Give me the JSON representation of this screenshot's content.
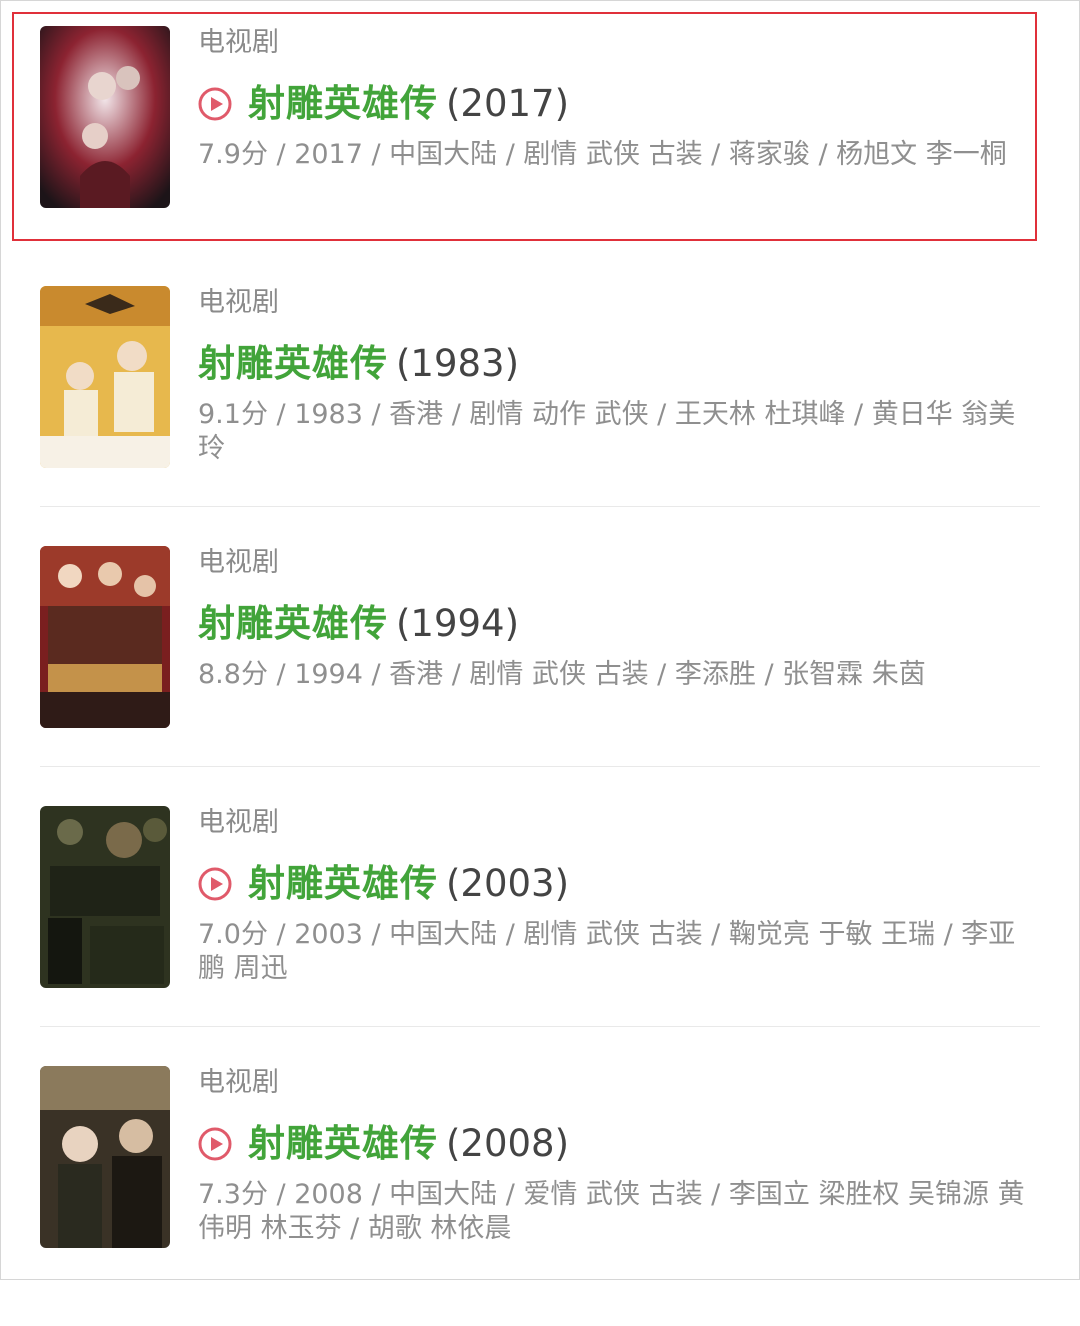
{
  "items": [
    {
      "category": "电视剧",
      "title": "射雕英雄传",
      "year": "(2017)",
      "meta": "7.9分 / 2017 / 中国大陆 / 剧情 武侠 古装 / 蒋家骏 / 杨旭文 李一桐",
      "has_play": true,
      "highlighted": true,
      "poster_colors": [
        "#f2e6ea",
        "#8c2331",
        "#1c1418"
      ]
    },
    {
      "category": "电视剧",
      "title": "射雕英雄传",
      "year": "(1983)",
      "meta": "9.1分 / 1983 / 香港 / 剧情 动作 武侠 / 王天林 杜琪峰 / 黄日华 翁美玲",
      "has_play": false,
      "highlighted": false,
      "poster_colors": [
        "#e7b84d",
        "#f5ecd6",
        "#c98a2e"
      ]
    },
    {
      "category": "电视剧",
      "title": "射雕英雄传",
      "year": "(1994)",
      "meta": "8.8分 / 1994 / 香港 / 剧情 武侠 古装 / 李添胜 / 张智霖 朱茵",
      "has_play": false,
      "highlighted": false,
      "poster_colors": [
        "#7a1f1f",
        "#c4924a",
        "#2f1b17"
      ]
    },
    {
      "category": "电视剧",
      "title": "射雕英雄传",
      "year": "(2003)",
      "meta": "7.0分 / 2003 / 中国大陆 / 剧情 武侠 古装 / 鞠觉亮 于敏 王瑞 / 李亚鹏 周迅",
      "has_play": true,
      "highlighted": false,
      "poster_colors": [
        "#2e3320",
        "#6a6a4a",
        "#14160f"
      ]
    },
    {
      "category": "电视剧",
      "title": "射雕英雄传",
      "year": "(2008)",
      "meta": "7.3分 / 2008 / 中国大陆 / 爱情 武侠 古装 / 李国立 梁胜权 吴锦源 黄伟明 林玉芬 / 胡歌 林依晨",
      "has_play": true,
      "highlighted": false,
      "poster_colors": [
        "#3a3226",
        "#8b7a5c",
        "#1c1812"
      ]
    }
  ],
  "colors": {
    "title_green": "#42a43a",
    "highlight_red": "#e0303a",
    "play_icon": "#e05a6a"
  }
}
